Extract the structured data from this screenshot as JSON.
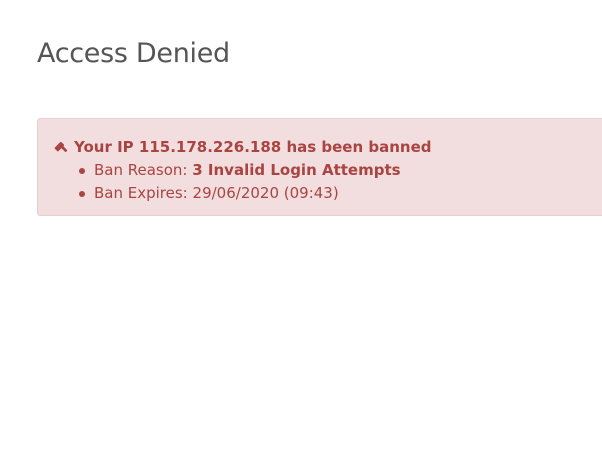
{
  "page": {
    "title": "Access Denied"
  },
  "alert": {
    "icon": "gavel-icon",
    "heading": "Your IP 115.178.226.188 has been banned",
    "reason_label": "Ban Reason:",
    "reason_value": "3 Invalid Login Attempts",
    "expires_label": "Ban Expires:",
    "expires_value": "29/06/2020 (09:43)",
    "colors": {
      "background": "#f2dede",
      "border": "#ebccd1",
      "text": "#a94442"
    }
  }
}
